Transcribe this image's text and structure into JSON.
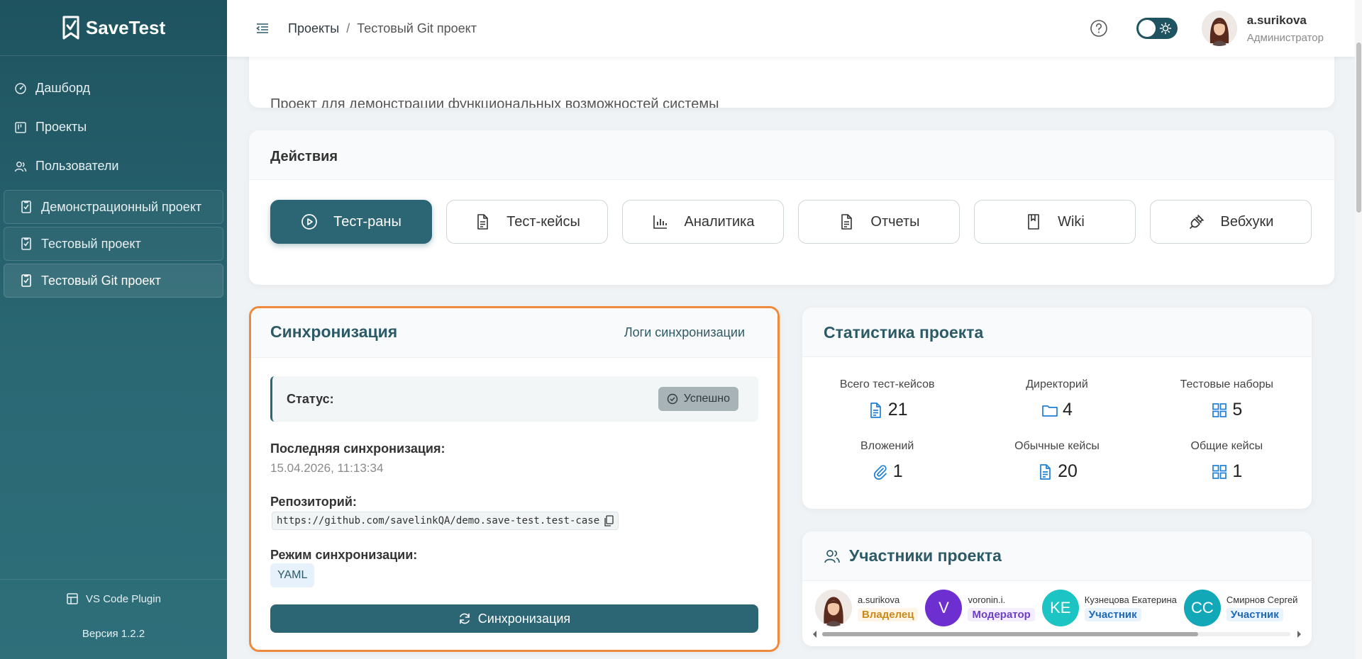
{
  "app": {
    "name": "SaveTest"
  },
  "sidebar": {
    "nav": [
      {
        "label": "Дашборд",
        "icon": "dashboard-icon"
      },
      {
        "label": "Проекты",
        "icon": "projects-icon"
      },
      {
        "label": "Пользователи",
        "icon": "users-icon"
      }
    ],
    "projects": [
      {
        "label": "Демонстрационный проект",
        "icon": "project-icon",
        "active": false
      },
      {
        "label": "Тестовый проект",
        "icon": "project-icon",
        "active": false
      },
      {
        "label": "Тестовый Git проект",
        "icon": "project-icon",
        "active": true
      }
    ],
    "plugin_label": "VS Code Plugin",
    "version": "Версия 1.2.2"
  },
  "header": {
    "breadcrumb": {
      "root": "Проекты",
      "separator": "/",
      "current": "Тестовый Git проект"
    },
    "user": {
      "name": "a.surikova",
      "role": "Администратор"
    }
  },
  "description": {
    "text": "Проект для демонстрации функциональных возможностей системы"
  },
  "actions": {
    "title": "Действия",
    "buttons": [
      {
        "label": "Тест-раны",
        "icon": "play-icon",
        "primary": true
      },
      {
        "label": "Тест-кейсы",
        "icon": "document-icon",
        "primary": false
      },
      {
        "label": "Аналитика",
        "icon": "bar-chart-icon",
        "primary": false
      },
      {
        "label": "Отчеты",
        "icon": "report-icon",
        "primary": false
      },
      {
        "label": "Wiki",
        "icon": "book-icon",
        "primary": false
      },
      {
        "label": "Вебхуки",
        "icon": "plug-icon",
        "primary": false
      }
    ]
  },
  "sync": {
    "title": "Синхронизация",
    "logs_link": "Логи синхронизации",
    "status_label": "Статус:",
    "status_value": "Успешно",
    "last_sync_label": "Последняя синхронизация:",
    "last_sync_value": "15.04.2026, 11:13:34",
    "repo_label": "Репозиторий:",
    "repo_url": "https://github.com/savelinkQA/demo.save-test.test-case",
    "mode_label": "Режим синхронизации:",
    "mode_value": "YAML",
    "button_label": "Синхронизация"
  },
  "stats": {
    "title": "Статистика проекта",
    "items": [
      {
        "label": "Всего тест-кейсов",
        "value": "21",
        "icon": "document-icon"
      },
      {
        "label": "Директорий",
        "value": "4",
        "icon": "folder-icon"
      },
      {
        "label": "Тестовые наборы",
        "value": "5",
        "icon": "grid-icon"
      },
      {
        "label": "Вложений",
        "value": "1",
        "icon": "paperclip-icon"
      },
      {
        "label": "Обычные кейсы",
        "value": "20",
        "icon": "document-icon"
      },
      {
        "label": "Общие кейсы",
        "value": "1",
        "icon": "grid-icon"
      }
    ]
  },
  "members": {
    "title": "Участники проекта",
    "list": [
      {
        "name": "a.surikova",
        "role": "Владелец",
        "initials": "",
        "color": "#ede7e3"
      },
      {
        "name": "voronin.i.",
        "role": "Модератор",
        "initials": "V",
        "color": "#6d2fd0"
      },
      {
        "name": "Кузнецова Екатерина",
        "role": "Участник",
        "initials": "KE",
        "color": "#1cc4c4"
      },
      {
        "name": "Смирнов Сергей",
        "role": "Участник",
        "initials": "CC",
        "color": "#13a8b8"
      }
    ]
  },
  "colors": {
    "accent": "#2c6574",
    "sidebar": "#1e535f",
    "highlight_border": "#ef8a3d"
  }
}
